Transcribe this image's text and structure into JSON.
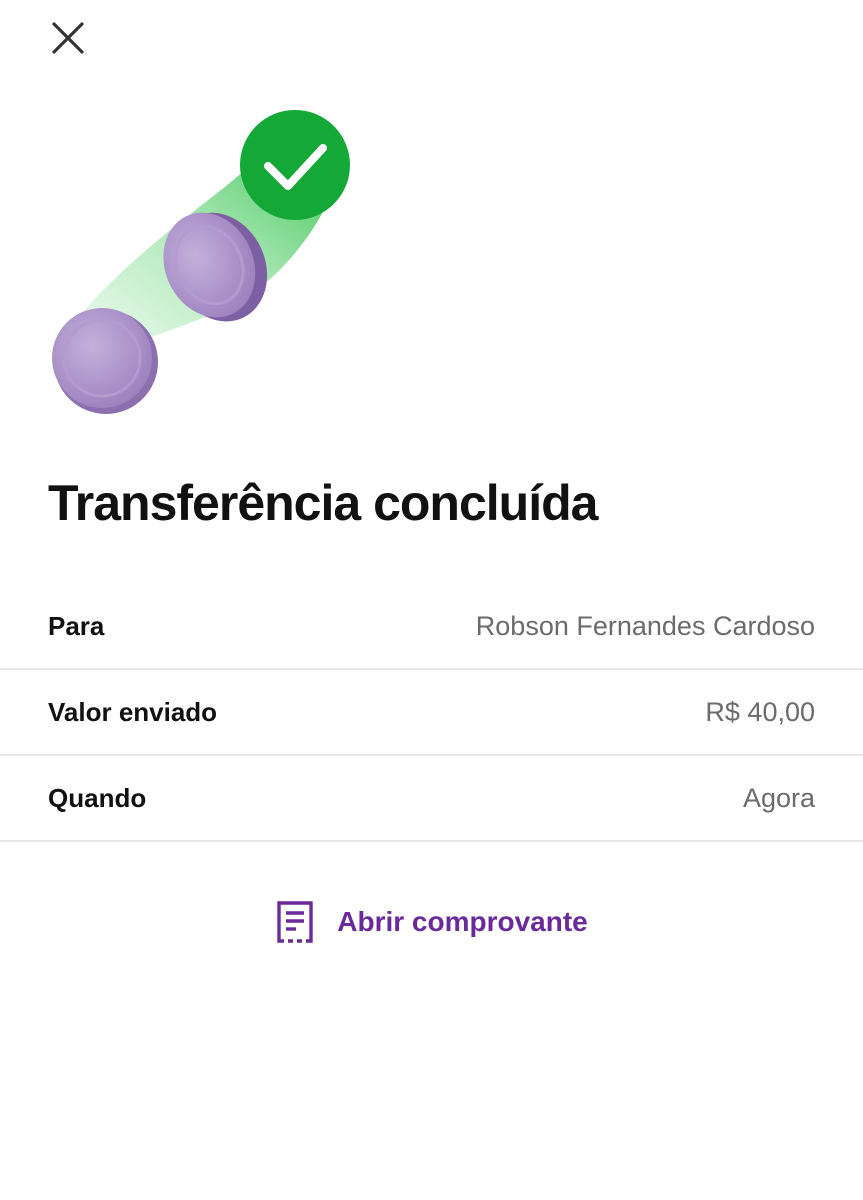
{
  "header": {
    "close_icon": "close-icon"
  },
  "illustration": {
    "icon": "coin-transfer-success-illustration",
    "check_icon": "check-icon",
    "colors": {
      "success_green": "#14a837",
      "coin_purple": "#a58cc4",
      "trail_green": "#56d06a"
    }
  },
  "main": {
    "title": "Transferência concluída"
  },
  "details": {
    "rows": [
      {
        "label": "Para",
        "value": "Robson Fernandes Cardoso"
      },
      {
        "label": "Valor enviado",
        "value": "R$ 40,00"
      },
      {
        "label": "Quando",
        "value": "Agora"
      }
    ]
  },
  "actions": {
    "receipt_label": "Abrir comprovante",
    "receipt_icon": "receipt-icon",
    "accent_color": "#6a2a9c"
  }
}
